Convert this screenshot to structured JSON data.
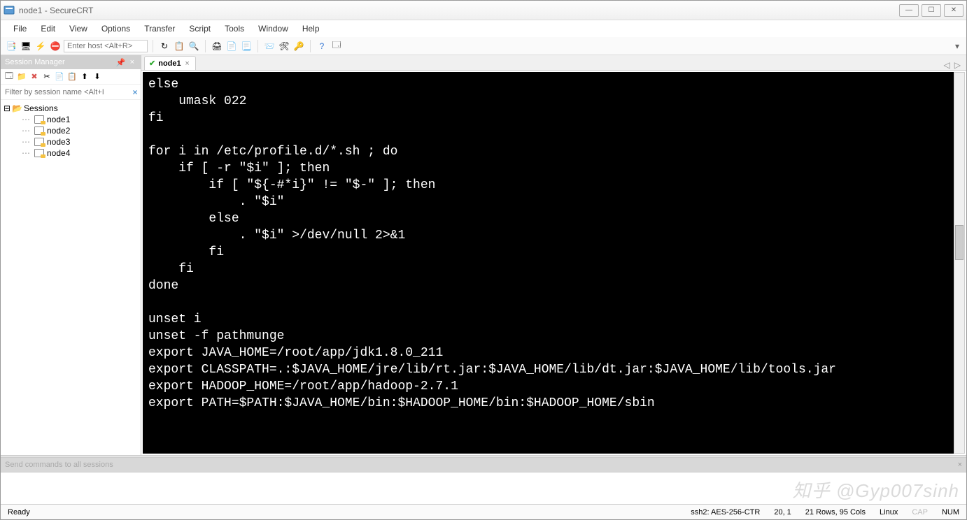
{
  "window": {
    "title": "node1 - SecureCRT"
  },
  "menus": [
    "File",
    "Edit",
    "View",
    "Options",
    "Transfer",
    "Script",
    "Tools",
    "Window",
    "Help"
  ],
  "toolbar": {
    "host_placeholder": "Enter host <Alt+R>"
  },
  "session_manager": {
    "title": "Session Manager",
    "filter_placeholder": "Filter by session name <Alt+I",
    "root": "Sessions",
    "items": [
      "node1",
      "node2",
      "node3",
      "node4"
    ]
  },
  "tab": {
    "label": "node1",
    "close": "×"
  },
  "terminal_lines": [
    "else",
    "    umask 022",
    "fi",
    "",
    "for i in /etc/profile.d/*.sh ; do",
    "    if [ -r \"$i\" ]; then",
    "        if [ \"${-#*i}\" != \"$-\" ]; then",
    "            . \"$i\"",
    "        else",
    "            . \"$i\" >/dev/null 2>&1",
    "        fi",
    "    fi",
    "done",
    "",
    "unset i",
    "unset -f pathmunge",
    "export JAVA_HOME=/root/app/jdk1.8.0_211",
    "export CLASSPATH=.:$JAVA_HOME/jre/lib/rt.jar:$JAVA_HOME/lib/dt.jar:$JAVA_HOME/lib/tools.jar",
    "export HADOOP_HOME=/root/app/hadoop-2.7.1",
    "export PATH=$PATH:$JAVA_HOME/bin:$HADOOP_HOME/bin:$HADOOP_HOME/sbin"
  ],
  "command_bar": {
    "label": "Send commands to all sessions",
    "close": "×"
  },
  "watermark": "知乎 @Gyp007sinh",
  "status": {
    "ready": "Ready",
    "cipher": "ssh2: AES-256-CTR",
    "pos": "20,   1",
    "size": "21 Rows, 95 Cols",
    "os": "Linux",
    "cap": "CAP",
    "num": "NUM"
  }
}
